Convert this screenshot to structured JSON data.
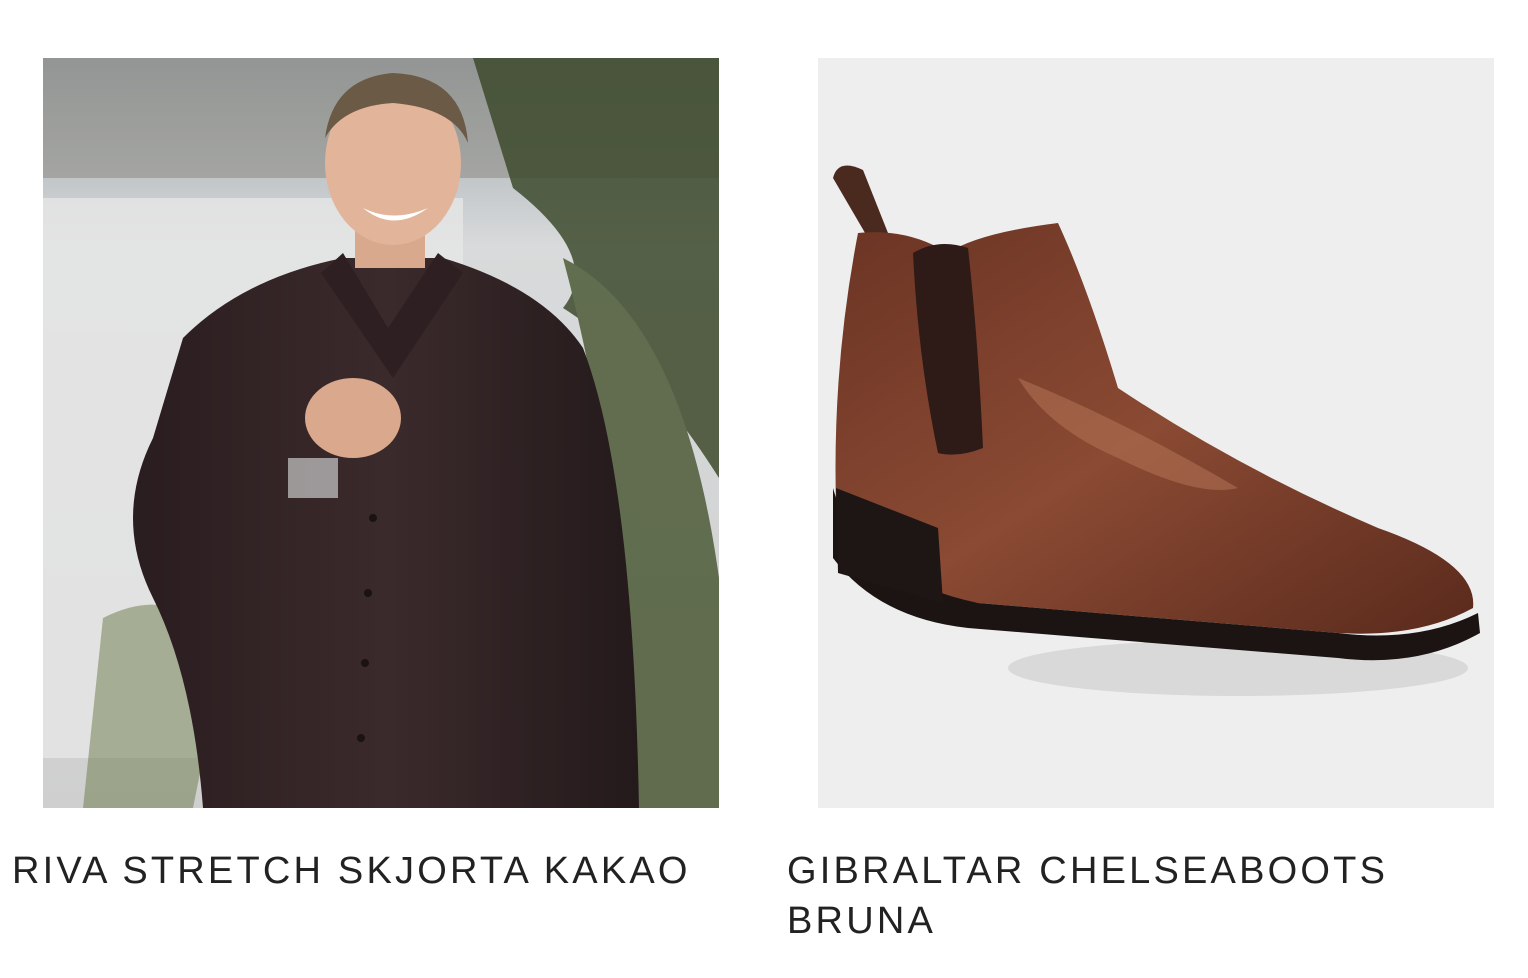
{
  "products": [
    {
      "title": "RIVA STRETCH SKJORTA KAKAO",
      "image": "man-in-dark-brown-shirt-photo",
      "image_background": "#d9d9d9"
    },
    {
      "title": "GIBRALTAR CHELSEABOOTS BRUNA",
      "image": "brown-chelsea-boot-photo",
      "image_background": "#eeeeee"
    }
  ]
}
